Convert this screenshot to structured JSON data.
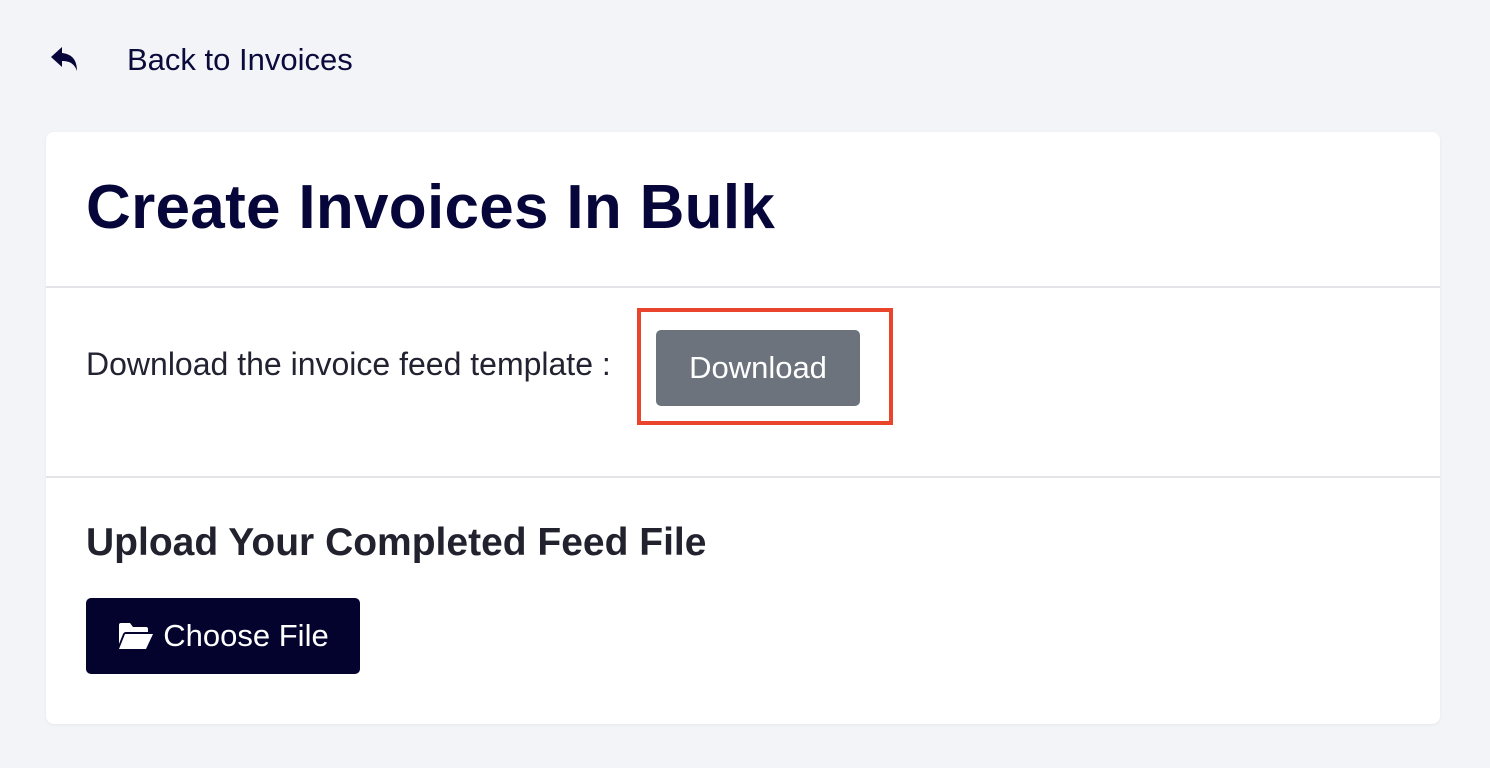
{
  "nav": {
    "back_label": "Back to Invoices",
    "back_icon": "reply-arrow-icon"
  },
  "page": {
    "title": "Create Invoices In Bulk"
  },
  "download": {
    "prompt": "Download the invoice feed template :",
    "button_label": "Download",
    "button_color": "#6c737c",
    "highlight_color": "#e8452c"
  },
  "upload": {
    "title": "Upload Your Completed Feed File",
    "button_label": "Choose File",
    "button_icon": "folder-open-icon",
    "button_color": "#03032e"
  },
  "colors": {
    "background": "#f3f4f8",
    "card": "#ffffff",
    "text_primary": "#06063a"
  }
}
